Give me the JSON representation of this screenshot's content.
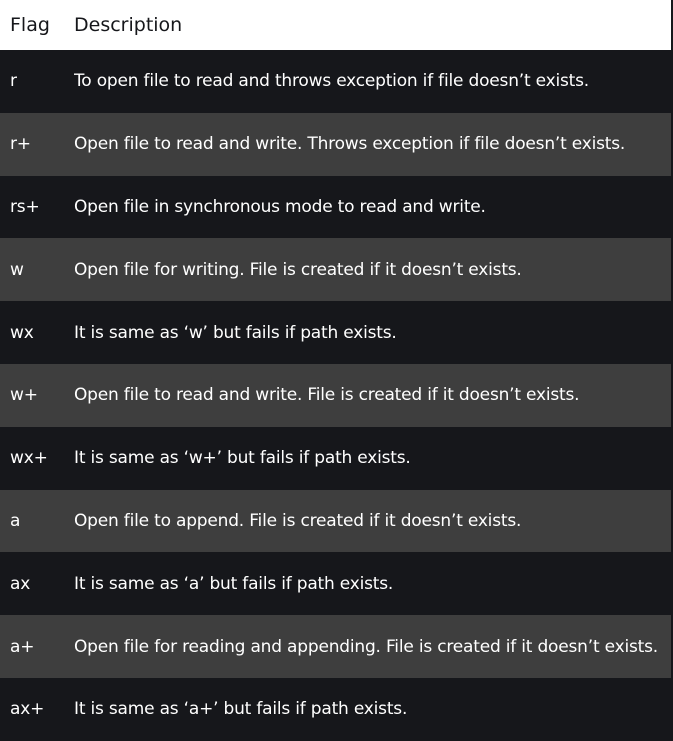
{
  "table": {
    "headers": {
      "flag": "Flag",
      "description": "Description"
    },
    "rows": [
      {
        "flag": "r",
        "description": "To open file to read and throws exception if file doesn’t exists."
      },
      {
        "flag": "r+",
        "description": "Open file to read and write. Throws exception if file doesn’t exists."
      },
      {
        "flag": "rs+",
        "description": "Open file in synchronous mode to read and write."
      },
      {
        "flag": "w",
        "description": "Open file for writing. File is created if it doesn’t exists."
      },
      {
        "flag": "wx",
        "description": "It is same as ‘w’ but fails if path exists."
      },
      {
        "flag": "w+",
        "description": "Open file to read and write. File is created if it doesn’t exists."
      },
      {
        "flag": "wx+",
        "description": "It is same as ‘w+’ but fails if path exists."
      },
      {
        "flag": "a",
        "description": "Open file to append. File is created if it doesn’t exists."
      },
      {
        "flag": "ax",
        "description": "It is same as ‘a’ but fails if path exists."
      },
      {
        "flag": "a+",
        "description": "Open file for reading and appending. File is created if it doesn’t exists."
      },
      {
        "flag": "ax+",
        "description": "It is same as ‘a+’ but fails if path exists."
      }
    ]
  },
  "colors": {
    "header_bg": "#ffffff",
    "row_dark": "#16171b",
    "row_light": "#3e3e3e",
    "text_light": "#ffffff",
    "text_dark": "#16171b"
  }
}
